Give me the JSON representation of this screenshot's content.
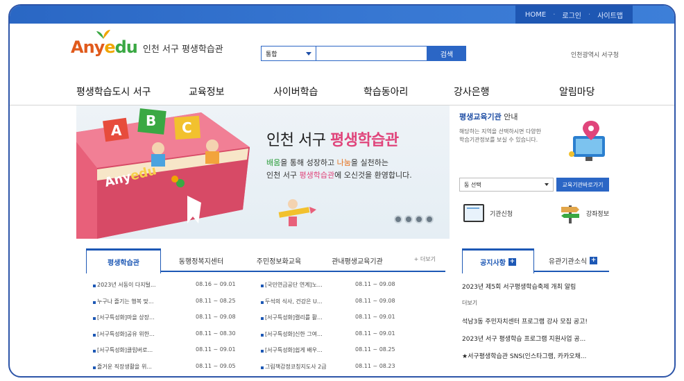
{
  "util_nav": [
    "HOME",
    "로그인",
    "사이트맵"
  ],
  "logo": {
    "brand": "Anyedu",
    "subtitle": "인천 서구 평생학습관"
  },
  "search": {
    "category": "통합",
    "button": "검색"
  },
  "header_right": "인천광역시 서구청",
  "gnb": [
    "평생학습도시 서구",
    "교육정보",
    "사이버학습",
    "학습동아리",
    "강사은행",
    "알림마당"
  ],
  "banner": {
    "title_a": "인천 서구 ",
    "title_b": "평생학습관",
    "line1_a": "배움",
    "line1_b": "을 통해 성장하고 ",
    "line1_c": "나눔",
    "line1_d": "을 실천하는",
    "line2_a": "인천 서구 ",
    "line2_b": "평생학습관",
    "line2_c": "에 오신것을 환영합니다.",
    "blocks": [
      "A",
      "B",
      "C"
    ]
  },
  "side": {
    "title_a": "평생교육기관",
    "title_b": " 안내",
    "desc": "해당하는 지역을 선택하시면 다양한 학습기관정보를 보실 수 있습니다.",
    "select": "동 선택",
    "go": "교육기관바로가기",
    "link1": "기관신청",
    "link2": "강좌정보"
  },
  "tabs1": [
    "평생학습관",
    "동행정복지센터",
    "주민정보화교육",
    "관내평생교육기관"
  ],
  "tabs1_more": "+ 더보기",
  "news_left": [
    {
      "title": "2023년 서동이 다지털...",
      "date": "08.16 ~ 09.01"
    },
    {
      "title": "누구나 즐기는 행복 맞...",
      "date": "08.11 ~ 08.25"
    },
    {
      "title": "[서구특성화]마을 상장...",
      "date": "08.11 ~ 09.08"
    },
    {
      "title": "[서구특성화]공유 위한...",
      "date": "08.11 ~ 08.30"
    },
    {
      "title": "[서구특성화]클립버로...",
      "date": "08.11 ~ 09.01"
    },
    {
      "title": "즐거운 직장생활을 위...",
      "date": "08.11 ~ 09.05"
    }
  ],
  "news_right": [
    {
      "title": "[국민연금공단 연계]노...",
      "date": "08.11 ~ 09.08"
    },
    {
      "title": "두석의 식사, 건강은 U...",
      "date": "08.11 ~ 09.08"
    },
    {
      "title": "[서구특성화]캘리를 활...",
      "date": "08.11 ~ 09.01"
    },
    {
      "title": "[서구특성화]신한 그여...",
      "date": "08.11 ~ 09.01"
    },
    {
      "title": "[서구특성화]쉽게 배우...",
      "date": "08.11 ~ 08.25"
    },
    {
      "title": "그림책감정코칭지도사 2급",
      "date": "08.11 ~ 08.23"
    }
  ],
  "tabs2": [
    "공지사항",
    "유관기관소식"
  ],
  "notices": [
    "2023년 제5회 서구평생학습축제 개최 알림",
    "더보기",
    "석남3동 주민자치센터 프로그램 강사 모집 공고!",
    "2023년 서구 평생학습 프로그램 지원사업 공...",
    "★서구평생학습관 SNS(인스타그램, 카카오채..."
  ],
  "colors": {
    "primary": "#2b66c5",
    "accent_pink": "#e0457b",
    "accent_green": "#2e9e3d"
  }
}
